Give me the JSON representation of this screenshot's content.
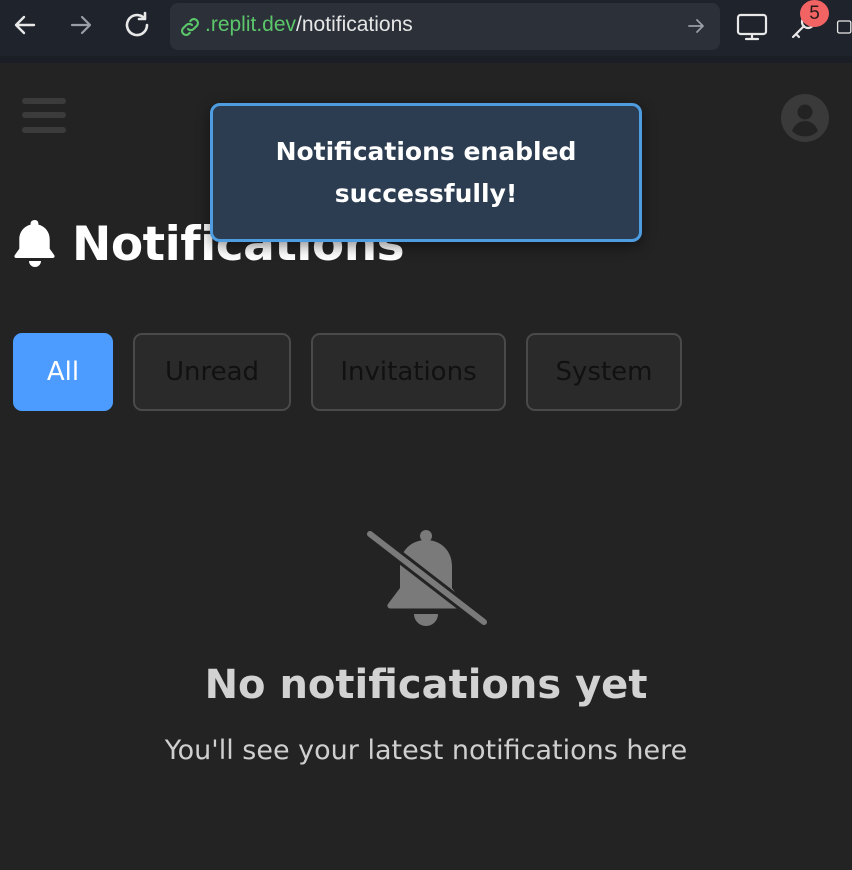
{
  "browser": {
    "url_domain": ".replit.dev",
    "url_path": "/notifications",
    "extensions_badge": "5"
  },
  "page": {
    "title": "Notifications"
  },
  "toast": {
    "message": "Notifications enabled successfully!"
  },
  "tabs": [
    {
      "label": "All",
      "active": true
    },
    {
      "label": "Unread",
      "active": false
    },
    {
      "label": "Invitations",
      "active": false
    },
    {
      "label": "System",
      "active": false
    }
  ],
  "empty_state": {
    "title": "No notifications yet",
    "subtitle": "You'll see your latest notifications here"
  },
  "colors": {
    "background": "#232323",
    "accent": "#4c9cff",
    "toast_bg": "#2c3d51",
    "toast_border": "#4d9de0",
    "badge": "#f26363",
    "url_domain": "#5bc76a"
  }
}
